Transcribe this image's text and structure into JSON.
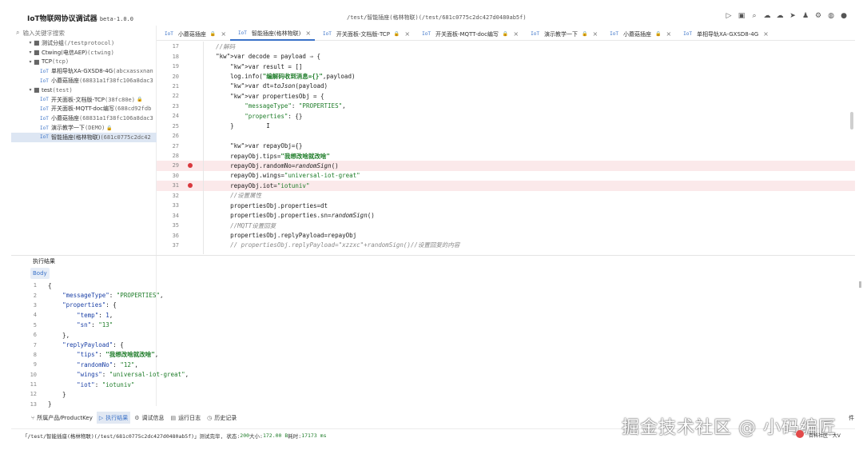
{
  "app": {
    "title": "IoT物联网协议调试器",
    "version": "beta-1.0.0",
    "window_path": "/test/智能插座(格林物联)(/test/681c0775c2dc427d0480ab5f)"
  },
  "toolbar_icons": [
    "play-icon",
    "save-icon",
    "search-icon",
    "cloud-download-icon",
    "cloud-upload-icon",
    "send-icon",
    "shirt-icon",
    "settings-icon",
    "globe-icon",
    "github-icon"
  ],
  "sidebar": {
    "search_placeholder": "输入关键字搜索",
    "nodes": [
      {
        "kind": "group",
        "label": "测试分组",
        "sub": "(/testprotocol)"
      },
      {
        "kind": "group",
        "label": "Ctwing(电信AEP)",
        "sub": "(ctwing)"
      },
      {
        "kind": "group",
        "label": "TCP",
        "sub": "(tcp)"
      },
      {
        "kind": "item",
        "label": "单相导轨XA-GXSD8-4G",
        "sub": "(abcxassxnan"
      },
      {
        "kind": "item",
        "label": "小蘑菇插座",
        "sub": "(68831a1f38fc106a8dac3"
      },
      {
        "kind": "group",
        "label": "test",
        "sub": "(test)"
      },
      {
        "kind": "item",
        "label": "开关面板-文档版-TCP",
        "sub": "(38fc80e)"
      },
      {
        "kind": "item",
        "label": "开关面板-MQTT-doc编写",
        "sub": "(688cd92fdb"
      },
      {
        "kind": "item",
        "label": "小蘑菇插座",
        "sub": "(68831a1f38fc106a8dac3"
      },
      {
        "kind": "item",
        "label": "演示教学一下",
        "sub": "(DEMO)"
      },
      {
        "kind": "item",
        "label": "智能插座(格林物联)",
        "sub": "(681c0775c2dc42"
      }
    ]
  },
  "tabs": [
    {
      "iot": "IoT",
      "label": "小蘑菇插座"
    },
    {
      "iot": "IoT",
      "label": "智能插座(格林物联)"
    },
    {
      "iot": "IoT",
      "label": "开关面板-文档版-TCP"
    },
    {
      "iot": "IoT",
      "label": "开关面板-MQTT-doc编写"
    },
    {
      "iot": "IoT",
      "label": "演示教学一下"
    },
    {
      "iot": "IoT",
      "label": "小蘑菇插座"
    },
    {
      "iot": "IoT",
      "label": "单相导轨XA-GXSD8-4G"
    }
  ],
  "editor": {
    "lines": [
      {
        "n": "17",
        "t": "    //解码"
      },
      {
        "n": "18",
        "t": "    var decode = payload ⇒ {"
      },
      {
        "n": "19",
        "t": "        var result = []"
      },
      {
        "n": "20",
        "t": "        log.info(\"编解码收到消息={}\",payload)"
      },
      {
        "n": "21",
        "t": "        var dt=toJson(payload)"
      },
      {
        "n": "22",
        "t": "        var propertiesObj = {"
      },
      {
        "n": "23",
        "t": "            \"messageType\": \"PROPERTIES\","
      },
      {
        "n": "24",
        "t": "            \"properties\": {}"
      },
      {
        "n": "25",
        "t": "        }         I"
      },
      {
        "n": "26",
        "t": ""
      },
      {
        "n": "27",
        "t": "        var repayObj={}"
      },
      {
        "n": "28",
        "t": "        repayObj.tips=\"我想改啥就改啥\""
      },
      {
        "n": "29",
        "t": "        repayObj.randomNo=randomSign()"
      },
      {
        "n": "30",
        "t": "        repayObj.wings=\"universal-iot-great\""
      },
      {
        "n": "31",
        "t": "        repayObj.iot=\"iotuniv\""
      },
      {
        "n": "32",
        "t": "        //设置属性"
      },
      {
        "n": "33",
        "t": "        propertiesObj.properties=dt"
      },
      {
        "n": "34",
        "t": "        propertiesObj.properties.sn=randomSign()"
      },
      {
        "n": "35",
        "t": "        //MQTT设置回复"
      },
      {
        "n": "36",
        "t": "        propertiesObj.replyPayload=repayObj"
      },
      {
        "n": "37",
        "t": "        // propertiesObj.replyPayload=\"xzzxc\"+randomSign()//设置回复的内容"
      }
    ],
    "breakpoints": [
      "29",
      "31"
    ]
  },
  "result": {
    "header": "执行结果",
    "body_tab": "Body",
    "lines": [
      {
        "n": "1",
        "t": "{"
      },
      {
        "n": "2",
        "t": "    \"messageType\": \"PROPERTIES\","
      },
      {
        "n": "3",
        "t": "    \"properties\": {"
      },
      {
        "n": "4",
        "t": "        \"temp\": 1,"
      },
      {
        "n": "5",
        "t": "        \"sn\": \"13\""
      },
      {
        "n": "6",
        "t": "    },"
      },
      {
        "n": "7",
        "t": "    \"replyPayload\": {"
      },
      {
        "n": "8",
        "t": "        \"tips\": \"我想改啥就改啥\","
      },
      {
        "n": "9",
        "t": "        \"randomNo\": \"12\","
      },
      {
        "n": "10",
        "t": "        \"wings\": \"universal-iot-great\","
      },
      {
        "n": "11",
        "t": "        \"iot\": \"iotuniv\""
      },
      {
        "n": "12",
        "t": "    }"
      },
      {
        "n": "13",
        "t": "}"
      }
    ]
  },
  "bottom_tabs": [
    {
      "icon": "product-icon",
      "label": "所属产品/ProductKey"
    },
    {
      "icon": "play-icon",
      "label": "执行结果",
      "active": true
    },
    {
      "icon": "debug-icon",
      "label": "调试信息"
    },
    {
      "icon": "log-icon",
      "label": "运行日志"
    },
    {
      "icon": "history-icon",
      "label": "历史记录"
    }
  ],
  "status": {
    "prefix": "「/test/智能插座(格林物联)(/test/681c0775c2dc427d0480ab5f)」测试完毕, 状态: ",
    "code": "200",
    "size_label": " 大小: ",
    "size": "172.00 B",
    "time_label": " 耗时: ",
    "time": "17173 ms"
  },
  "watermark": {
    "text": "掘金技术社区 @ 小码编匠",
    "sub": "百科社区 · 大V",
    "right": "件"
  }
}
